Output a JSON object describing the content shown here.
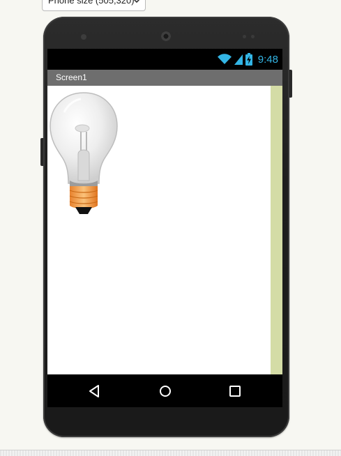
{
  "toolbar": {
    "phone_size_select": "Phone size (505,320)"
  },
  "status_bar": {
    "time": "9:48",
    "wifi_icon": "wifi-icon",
    "signal_icon": "signal-icon",
    "battery_icon": "battery-charging-icon",
    "accent_color": "#33b5e5"
  },
  "app": {
    "screen_title": "Screen1",
    "title_bar_color": "#6e6e6e",
    "scrollbar_color": "#d4dca6",
    "image_component": "lightbulb-image"
  },
  "nav_bar": {
    "back_icon": "back-triangle-icon",
    "home_icon": "home-circle-icon",
    "recents_icon": "recents-square-icon"
  }
}
